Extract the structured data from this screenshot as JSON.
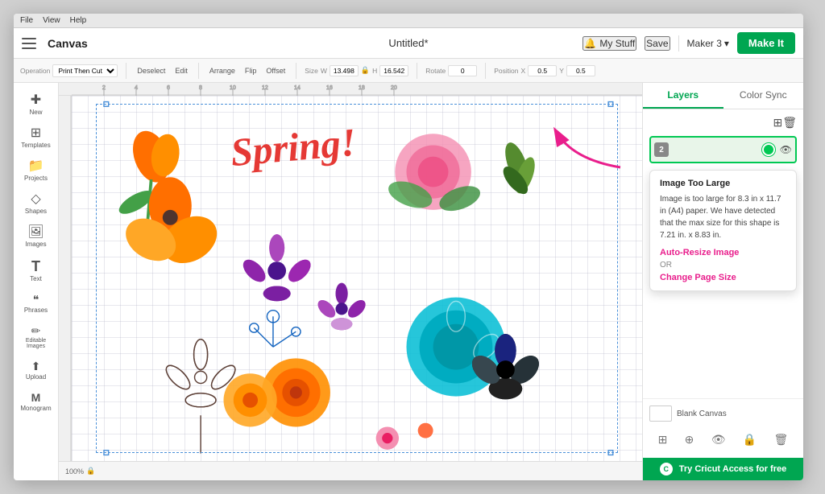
{
  "titleBar": {
    "appName": "Canvas",
    "menus": [
      "File",
      "View",
      "Help"
    ]
  },
  "appTitle": "Untitled*",
  "topRight": {
    "notification_icon": "🔔",
    "myStuff": "My Stuff",
    "save": "Save",
    "divider": "|",
    "maker": "Maker 3",
    "makeIt": "Make It"
  },
  "subToolbar": {
    "operationLabel": "Operation",
    "operationValue": "Print Then Cut",
    "deselect": "Deselect",
    "edit": "Edit",
    "arrange": "Arrange",
    "flip": "Flip",
    "offset": "Offset",
    "sizeLabel": "Size",
    "width": "13.498",
    "height": "16.542",
    "lockIcon": "🔒",
    "rotateLabel": "Rotate",
    "rotateValue": "0",
    "positionLabel": "Position",
    "posX": "0.5",
    "posY": "0.5"
  },
  "leftSidebar": {
    "items": [
      {
        "name": "new",
        "icon": "✚",
        "label": "New"
      },
      {
        "name": "templates",
        "icon": "⊞",
        "label": "Templates"
      },
      {
        "name": "projects",
        "icon": "📁",
        "label": "Projects"
      },
      {
        "name": "shapes",
        "icon": "◇",
        "label": "Shapes"
      },
      {
        "name": "images",
        "icon": "🖼",
        "label": "Images"
      },
      {
        "name": "text",
        "icon": "T",
        "label": "Text"
      },
      {
        "name": "phrases",
        "icon": "❝",
        "label": "Phrases"
      },
      {
        "name": "editable-images",
        "icon": "✏",
        "label": "Editable Images"
      },
      {
        "name": "upload",
        "icon": "⬆",
        "label": "Upload"
      },
      {
        "name": "monogram",
        "icon": "M",
        "label": "Monogram"
      }
    ]
  },
  "rightPanel": {
    "tabs": [
      "Layers",
      "Color Sync"
    ],
    "activeTab": "Layers",
    "layerItem": {
      "num": "2",
      "eyeIcon": "👁"
    },
    "errorTooltip": {
      "title": "Image Too Large",
      "body": "Image is too large for 8.3 in x 11.7 in (A4) paper. We have detected that the max size for this shape is 7.21 in. x 8.83 in.",
      "autoResize": "Auto-Resize Image",
      "or": "OR",
      "changePageSize": "Change Page Size"
    },
    "blankCanvas": "Blank Canvas",
    "tryBar": {
      "icon": "C",
      "text": "Try Cricut Access for free"
    }
  },
  "canvas": {
    "zoom": "100%",
    "rulerTicks": [
      "2",
      "4",
      "6",
      "8",
      "10",
      "12",
      "14",
      "16",
      "18",
      "20"
    ]
  },
  "colors": {
    "accent": "#00a651",
    "pink": "#e91e8c",
    "layerBorder": "#00c853"
  }
}
